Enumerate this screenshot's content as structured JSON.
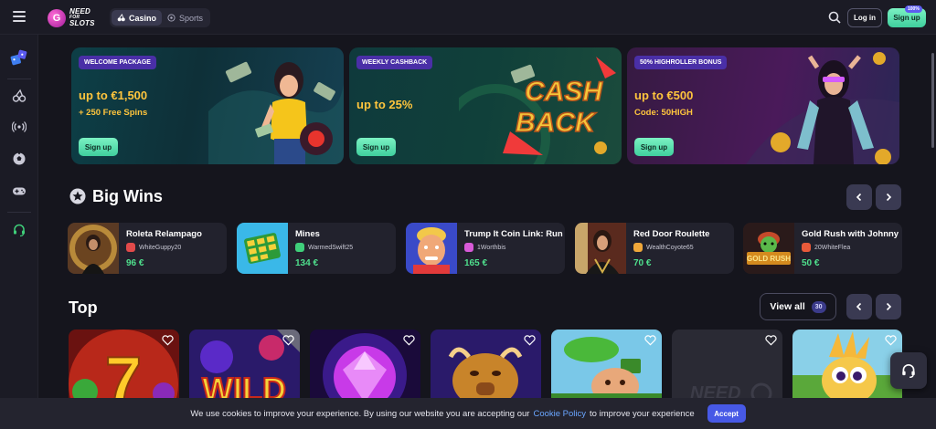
{
  "header": {
    "logo_lines": [
      "NEED",
      "FOR",
      "SLOTS"
    ],
    "tabs": [
      {
        "label": "Casino",
        "active": true,
        "icon": "cherry-icon"
      },
      {
        "label": "Sports",
        "active": false,
        "icon": "soccer-ball-icon"
      }
    ],
    "login_label": "Log in",
    "signup_label": "Sign up",
    "signup_badge": "100%"
  },
  "sidebar": {
    "items": [
      "promotions-icon",
      "cherry-icon",
      "live-casino-icon",
      "soccer-ball-icon",
      "gamepad-icon",
      "support-headset-icon"
    ]
  },
  "banners": [
    {
      "tag": "WELCOME PACKAGE",
      "headline": "up to €1,500",
      "subline": "+ 250 Free Spins",
      "button": "Sign up"
    },
    {
      "tag": "WEEKLY CASHBACK",
      "headline": "up to 25%",
      "subline": "",
      "button": "Sign up",
      "art_text": [
        "CASH",
        "BACK"
      ]
    },
    {
      "tag": "50% HIGHROLLER BONUS",
      "headline": "up to €500",
      "subline": "Code: 50HIGH",
      "button": "Sign up"
    }
  ],
  "big_wins": {
    "title": "Big Wins",
    "items": [
      {
        "game": "Roleta Relampago",
        "user": "WhiteGuppy20",
        "amount": "96 €"
      },
      {
        "game": "Mines",
        "user": "WarmedSwift25",
        "amount": "134 €"
      },
      {
        "game": "Trump It Coin Link: Running Wins",
        "user": "1Worthbis",
        "amount": "165 €"
      },
      {
        "game": "Red Door Roulette",
        "user": "WealthCoyote65",
        "amount": "70 €"
      },
      {
        "game": "Gold Rush with Johnny Cash",
        "user": "20WhiteFlea",
        "amount": "50 €"
      }
    ]
  },
  "top": {
    "title": "Top",
    "view_all_label": "View all",
    "view_all_count": "30",
    "games": [
      "sevens",
      "wild",
      "gem",
      "buffalo",
      "leprechaun",
      "placeholder",
      "bird"
    ]
  },
  "cookie": {
    "text_before": "We use cookies to improve your experience. By using our website you are accepting our",
    "link": "Cookie Policy",
    "text_after": "to improve your experience",
    "accept": "Accept"
  },
  "colors": {
    "accent_green": "#4fe08d",
    "cta": "#5ce0b0",
    "tag_purple": "#4a2fa7",
    "promo_yellow": "#ffc53d"
  }
}
